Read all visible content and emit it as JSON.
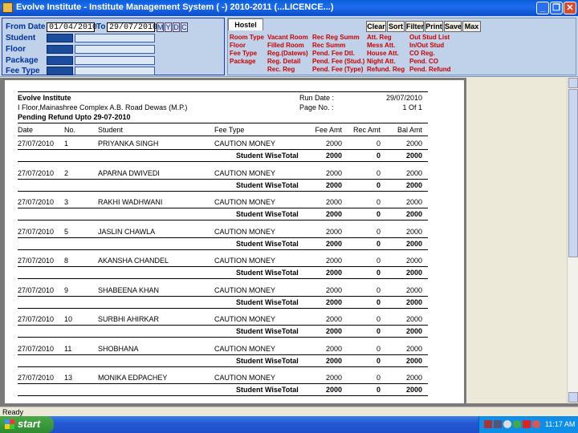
{
  "window": {
    "title": "Evolve Institute - Institute Management System ( -) 2010-2011 (...LICENCE...)"
  },
  "filters": {
    "from_label": "From Date",
    "from_value": "01/04/2010",
    "to_label": "To",
    "to_value": "29/07/2010",
    "m": "M",
    "y": "Y",
    "d": "D",
    "c": "C",
    "student": "Student",
    "floor": "Floor",
    "package": "Package",
    "fee_type": "Fee Type"
  },
  "hostel": {
    "tab": "Hostel",
    "buttons": [
      "Clear",
      "Sort",
      "Filter",
      "Print",
      "Save",
      "Max"
    ],
    "links": [
      [
        "Room Type",
        "Vacant Room",
        "Rec Reg Summ",
        "Att. Reg",
        "Out Stud List"
      ],
      [
        "Floor",
        "Filled Room",
        "Rec Summ",
        "Mess Att.",
        "In/Out Stud"
      ],
      [
        "Fee Type",
        "Reg.(Datews)",
        "Pend. Fee Dtl.",
        "House Att.",
        "CO Reg."
      ],
      [
        "Package",
        "Reg. Detail",
        "Pend. Fee (Stud.)",
        "Night Att.",
        "Pend. CO"
      ],
      [
        "",
        "Rec. Reg",
        "Pend. Fee (Type)",
        "Refund. Reg",
        "Pend. Refund"
      ]
    ]
  },
  "report": {
    "institute": "Evolve Institute",
    "address": "I Floor,Mainashree Complex A.B. Road Dewas (M.P.)",
    "run_date_label": "Run Date :",
    "run_date": "29/07/2010",
    "page_label": "Page No. :",
    "page_value": "1 Of 1",
    "heading": "Pending Refund Upto 29-07-2010",
    "columns": [
      "Date",
      "No.",
      "Student",
      "Fee Type",
      "Fee Amt",
      "Rec Amt",
      "Bal Amt"
    ],
    "subtotal_label": "Student WiseTotal",
    "rows": [
      {
        "date": "27/07/2010",
        "no": "1",
        "student": "PRIYANKA SINGH",
        "fee_type": "CAUTION MONEY",
        "fee": "2000",
        "rec": "0",
        "bal": "2000"
      },
      {
        "date": "27/07/2010",
        "no": "2",
        "student": "APARNA  DWIVEDI",
        "fee_type": "CAUTION MONEY",
        "fee": "2000",
        "rec": "0",
        "bal": "2000"
      },
      {
        "date": "27/07/2010",
        "no": "3",
        "student": "RAKHI WADHWANI",
        "fee_type": "CAUTION MONEY",
        "fee": "2000",
        "rec": "0",
        "bal": "2000"
      },
      {
        "date": "27/07/2010",
        "no": "5",
        "student": "JASLIN  CHAWLA",
        "fee_type": "CAUTION MONEY",
        "fee": "2000",
        "rec": "0",
        "bal": "2000"
      },
      {
        "date": "27/07/2010",
        "no": "8",
        "student": "AKANSHA CHANDEL",
        "fee_type": "CAUTION MONEY",
        "fee": "2000",
        "rec": "0",
        "bal": "2000"
      },
      {
        "date": "27/07/2010",
        "no": "9",
        "student": "SHABEENA KHAN",
        "fee_type": "CAUTION MONEY",
        "fee": "2000",
        "rec": "0",
        "bal": "2000"
      },
      {
        "date": "27/07/2010",
        "no": "10",
        "student": "SURBHI  AHIRKAR",
        "fee_type": "CAUTION MONEY",
        "fee": "2000",
        "rec": "0",
        "bal": "2000"
      },
      {
        "date": "27/07/2010",
        "no": "11",
        "student": "SHOBHANA",
        "fee_type": "CAUTION MONEY",
        "fee": "2000",
        "rec": "0",
        "bal": "2000"
      },
      {
        "date": "27/07/2010",
        "no": "13",
        "student": "MONIKA  EDPACHEY",
        "fee_type": "CAUTION MONEY",
        "fee": "2000",
        "rec": "0",
        "bal": "2000"
      }
    ],
    "subtotals": [
      {
        "fee": "2000",
        "rec": "0",
        "bal": "2000"
      },
      {
        "fee": "2000",
        "rec": "0",
        "bal": "2000"
      },
      {
        "fee": "2000",
        "rec": "0",
        "bal": "2000"
      },
      {
        "fee": "2000",
        "rec": "0",
        "bal": "2000"
      },
      {
        "fee": "2000",
        "rec": "0",
        "bal": "2000"
      },
      {
        "fee": "2000",
        "rec": "0",
        "bal": "2000"
      },
      {
        "fee": "2000",
        "rec": "0",
        "bal": "2000"
      },
      {
        "fee": "2000",
        "rec": "0",
        "bal": "2000"
      },
      {
        "fee": "2000",
        "rec": "0",
        "bal": "2000"
      }
    ]
  },
  "status": {
    "text": "Ready"
  },
  "taskbar": {
    "start": "start",
    "clock": "11:17 AM"
  }
}
